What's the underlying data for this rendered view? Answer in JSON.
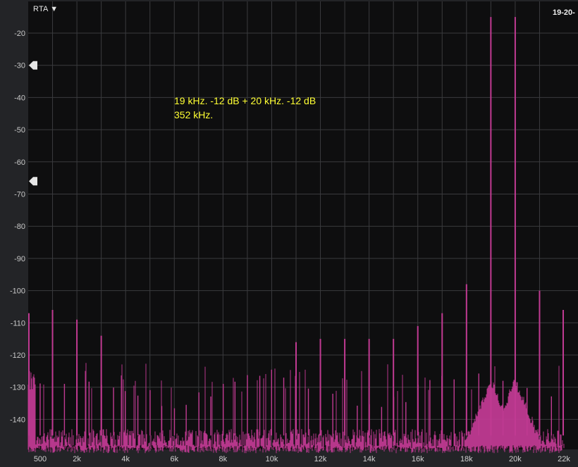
{
  "header": {
    "mode_label": "RTA ▼",
    "corner_label": "19-20-"
  },
  "colors": {
    "trace": "#c03a92",
    "annotation": "#ffff33",
    "grid": "#3a3b3e",
    "plot_background": "#0e0e0f"
  },
  "annotation": {
    "line1": "19 kHz. -12 dB + 20 kHz. -12 dB",
    "line2": "352 kHz."
  },
  "markers": [
    {
      "name": "upper-threshold-marker",
      "value": -30
    },
    {
      "name": "lower-threshold-marker",
      "value": -66
    }
  ],
  "chart_data": {
    "type": "line",
    "xlim": [
      0,
      22000
    ],
    "ylim": [
      -150,
      -15
    ],
    "grid": true,
    "x_ticks": [
      {
        "value": 500,
        "label": "500"
      },
      {
        "value": 2000,
        "label": "2k"
      },
      {
        "value": 4000,
        "label": "4k"
      },
      {
        "value": 6000,
        "label": "6k"
      },
      {
        "value": 8000,
        "label": "8k"
      },
      {
        "value": 10000,
        "label": "10k"
      },
      {
        "value": 12000,
        "label": "12k"
      },
      {
        "value": 14000,
        "label": "14k"
      },
      {
        "value": 16000,
        "label": "16k"
      },
      {
        "value": 18000,
        "label": "18k"
      },
      {
        "value": 20000,
        "label": "20k"
      },
      {
        "value": 22000,
        "label": "22k"
      }
    ],
    "y_ticks": [
      {
        "value": -20,
        "label": "-20"
      },
      {
        "value": -30,
        "label": "-30"
      },
      {
        "value": -40,
        "label": "-40"
      },
      {
        "value": -50,
        "label": "-50"
      },
      {
        "value": -60,
        "label": "-60"
      },
      {
        "value": -70,
        "label": "-70"
      },
      {
        "value": -80,
        "label": "-80"
      },
      {
        "value": -90,
        "label": "-90"
      },
      {
        "value": -100,
        "label": "-100"
      },
      {
        "value": -110,
        "label": "-110"
      },
      {
        "value": -120,
        "label": "-120"
      },
      {
        "value": -130,
        "label": "-130"
      },
      {
        "value": -140,
        "label": "-140"
      }
    ],
    "noise_floor_db": -146,
    "peaks": [
      {
        "x": 0,
        "y": -107
      },
      {
        "x": 1000,
        "y": -106
      },
      {
        "x": 2000,
        "y": -109
      },
      {
        "x": 3000,
        "y": -114
      },
      {
        "x": 19000,
        "y": -15
      },
      {
        "x": 20000,
        "y": -15
      },
      {
        "x": 18000,
        "y": -98
      },
      {
        "x": 21000,
        "y": -100
      },
      {
        "x": 17000,
        "y": -107
      },
      {
        "x": 22000,
        "y": -106
      },
      {
        "x": 16000,
        "y": -111
      },
      {
        "x": 15000,
        "y": -115
      },
      {
        "x": 14000,
        "y": -115
      },
      {
        "x": 13000,
        "y": -115
      },
      {
        "x": 12000,
        "y": -115
      },
      {
        "x": 11000,
        "y": -116
      }
    ]
  }
}
